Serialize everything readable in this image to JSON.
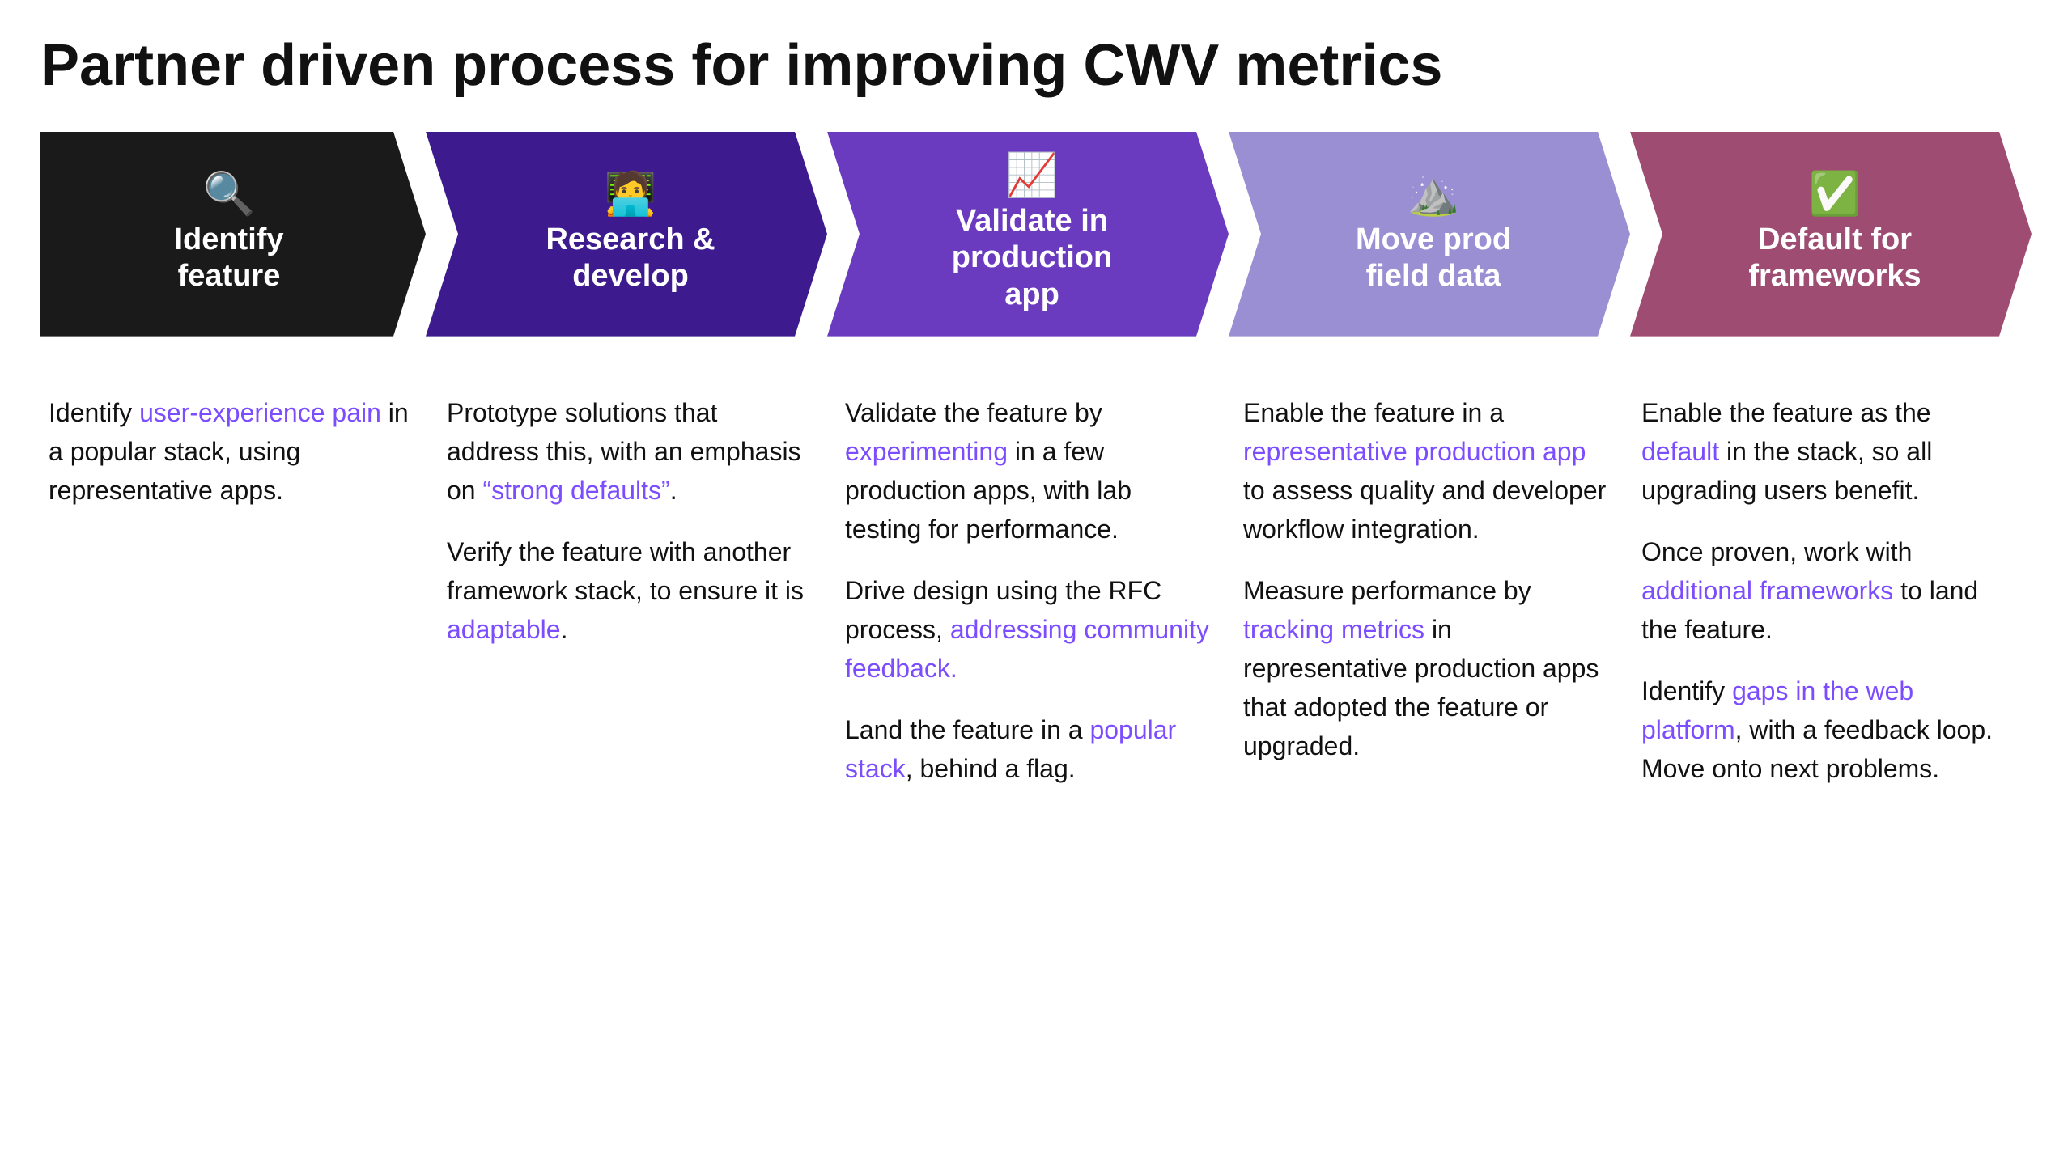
{
  "page": {
    "title": "Partner driven process for improving CWV metrics"
  },
  "steps": [
    {
      "id": "identify-feature",
      "icon": "🔍",
      "label": "Identify\nfeature",
      "color": "#1a1a1a",
      "paragraphs": [
        {
          "parts": [
            {
              "text": "Identify ",
              "type": "normal"
            },
            {
              "text": "user-experience pain",
              "type": "link"
            },
            {
              "text": " in a popular stack, using representative apps.",
              "type": "normal"
            }
          ]
        }
      ]
    },
    {
      "id": "research-develop",
      "icon": "🧑‍💻",
      "label": "Research &\ndevelop",
      "color": "#3d1a8e",
      "paragraphs": [
        {
          "parts": [
            {
              "text": "Prototype solutions that address this, with an emphasis on ",
              "type": "normal"
            },
            {
              "text": "“strong defaults”",
              "type": "link"
            },
            {
              "text": ".",
              "type": "normal"
            }
          ]
        },
        {
          "parts": [
            {
              "text": "Verify the feature with another framework stack, to ensure it is ",
              "type": "normal"
            },
            {
              "text": "adaptable",
              "type": "link"
            },
            {
              "text": ".",
              "type": "normal"
            }
          ]
        }
      ]
    },
    {
      "id": "validate-production",
      "icon": "📈",
      "label": "Validate in\nproduction\napp",
      "color": "#6a3bbf",
      "paragraphs": [
        {
          "parts": [
            {
              "text": "Validate the feature by ",
              "type": "normal"
            },
            {
              "text": "experimenting",
              "type": "link"
            },
            {
              "text": " in a few production apps, with lab testing for performance.",
              "type": "normal"
            }
          ]
        },
        {
          "parts": [
            {
              "text": "Drive design using the RFC process, ",
              "type": "normal"
            },
            {
              "text": "addressing community feedback.",
              "type": "link"
            }
          ]
        },
        {
          "parts": [
            {
              "text": "Land the feature in a ",
              "type": "normal"
            },
            {
              "text": "popular stack",
              "type": "link"
            },
            {
              "text": ", behind a flag.",
              "type": "normal"
            }
          ]
        }
      ]
    },
    {
      "id": "move-prod-field-data",
      "icon": "⛰️",
      "label": "Move prod\nfield data",
      "color": "#9b8fd4",
      "paragraphs": [
        {
          "parts": [
            {
              "text": "Enable the feature in a ",
              "type": "normal"
            },
            {
              "text": "representative production app",
              "type": "link"
            },
            {
              "text": " to assess quality and developer workflow integration.",
              "type": "normal"
            }
          ]
        },
        {
          "parts": [
            {
              "text": "Measure performance by ",
              "type": "normal"
            },
            {
              "text": "tracking metrics",
              "type": "link"
            },
            {
              "text": " in representative production apps that adopted the feature or upgraded.",
              "type": "normal"
            }
          ]
        }
      ]
    },
    {
      "id": "default-frameworks",
      "icon": "✅",
      "label": "Default for\nframeworks",
      "color": "#9e4c72",
      "paragraphs": [
        {
          "parts": [
            {
              "text": "Enable the feature as the ",
              "type": "normal"
            },
            {
              "text": "default",
              "type": "link"
            },
            {
              "text": " in the stack, so all upgrading users benefit.",
              "type": "normal"
            }
          ]
        },
        {
          "parts": [
            {
              "text": "Once proven, work with ",
              "type": "normal"
            },
            {
              "text": "additional frameworks",
              "type": "link"
            },
            {
              "text": " to land the feature.",
              "type": "normal"
            }
          ]
        },
        {
          "parts": [
            {
              "text": "Identify ",
              "type": "normal"
            },
            {
              "text": "gaps in the web platform",
              "type": "link"
            },
            {
              "text": ", with a feedback loop. Move onto next problems.",
              "type": "normal"
            }
          ]
        }
      ]
    }
  ]
}
